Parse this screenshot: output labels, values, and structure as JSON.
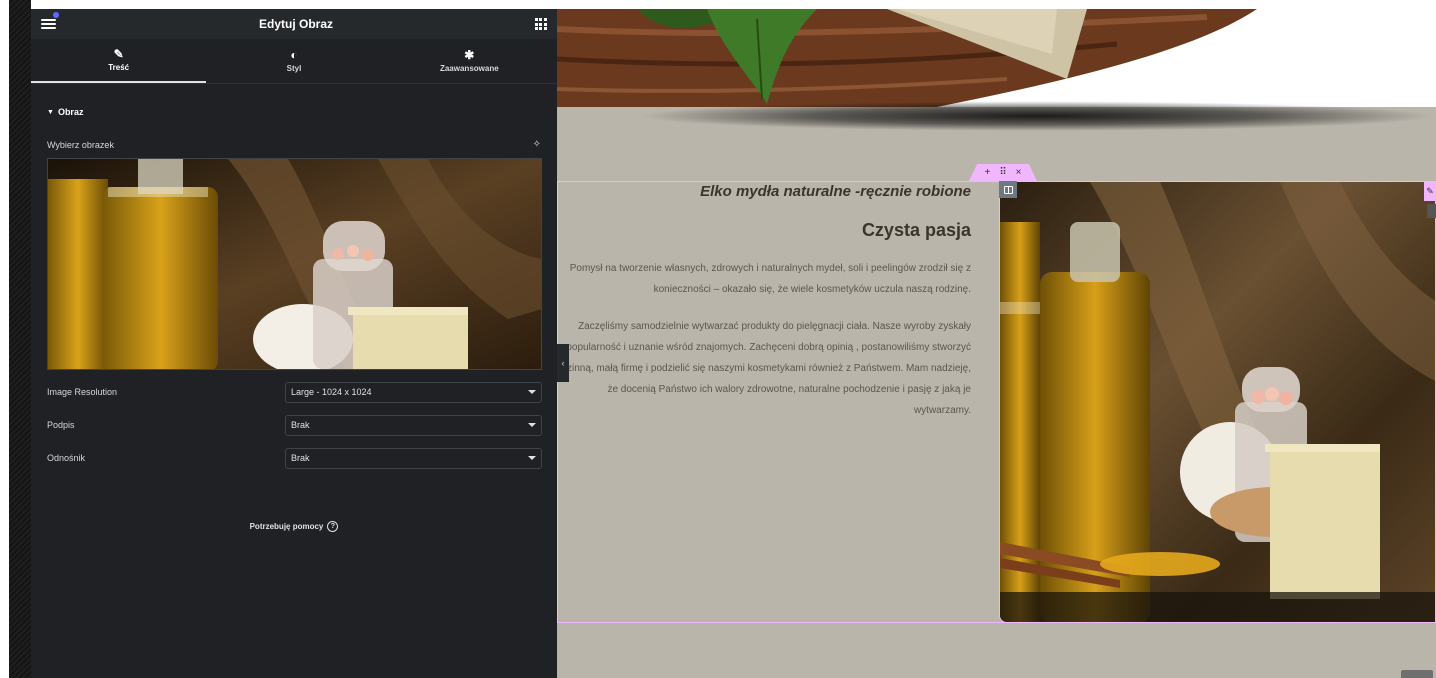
{
  "editor": {
    "title": "Edytuj Obraz",
    "tabs": [
      {
        "label": "Treść",
        "icon": "pencil-icon"
      },
      {
        "label": "Styl",
        "icon": "contrast-icon"
      },
      {
        "label": "Zaawansowane",
        "icon": "gear-icon"
      }
    ],
    "section_title": "Obraz",
    "choose_image_label": "Wybierz obrazek",
    "fields": [
      {
        "label": "Image Resolution",
        "value": "Large - 1024 x 1024"
      },
      {
        "label": "Podpis",
        "value": "Brak"
      },
      {
        "label": "Odnośnik",
        "value": "Brak"
      }
    ],
    "help_label": "Potrzebuję pomocy",
    "colors": {
      "panel_bg": "#1f2124",
      "accent": "#f0b7ff"
    }
  },
  "preview": {
    "subtitle": "Elko mydła naturalne -ręcznie robione",
    "heading": "Czysta pasja",
    "paragraph1": "Pomysł na tworzenie własnych, zdrowych i naturalnych mydeł, soli i peelingów zrodził się z konieczności – okazało się, że wiele kosmetyków uczula naszą rodzinę.",
    "paragraph2": "Zaczęliśmy samodzielnie wytwarzać produkty do pielęgnacji ciała. Nasze wyroby zyskały popularność i uznanie wśród znajomych. Zachęceni dobrą opinią , postanowiliśmy stworzyć rodzinną, małą firmę i podzielić się naszymi kosmetykami również z Państwem. Mam nadzieję, że docenią Państwo ich walory zdrowotne, naturalne pochodzenie i pasję z jaką je wytwarzamy.",
    "section_controls": {
      "add": "+",
      "move": "⠿",
      "close": "×"
    }
  }
}
